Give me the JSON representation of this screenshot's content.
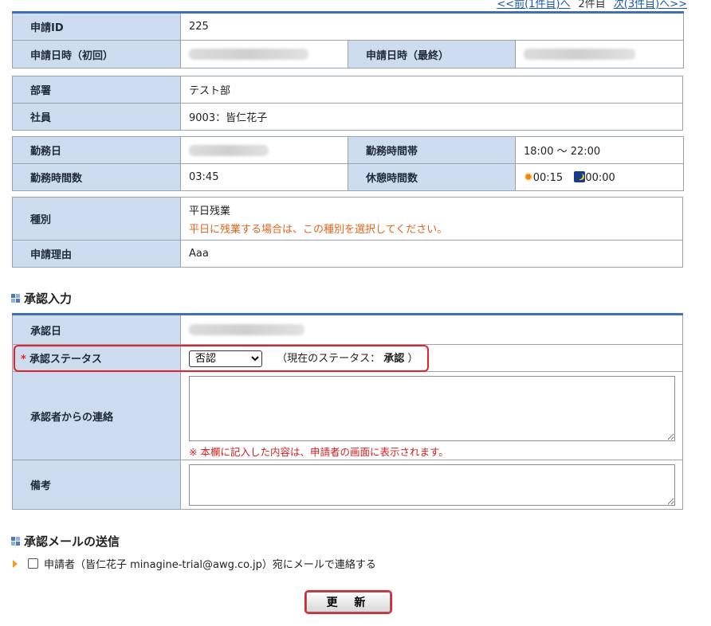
{
  "nav": {
    "prev": "<<前(1件目)へ",
    "current": "2件目",
    "next": "次(3件目)へ>>"
  },
  "request": {
    "id_label": "申請ID",
    "id_value": "225",
    "first_label": "申請日時（初回）",
    "last_label": "申請日時（最終）"
  },
  "employee": {
    "dept_label": "部署",
    "dept_value": "テスト部",
    "emp_label": "社員",
    "emp_value": "9003：皆仁花子"
  },
  "work": {
    "date_label": "勤務日",
    "timeband_label": "勤務時間帯",
    "timeband_value": "18:00 ～ 22:00",
    "hours_label": "勤務時間数",
    "hours_value": "03:45",
    "break_label": "休憩時間数",
    "break_day": "00:15",
    "break_night": "00:00"
  },
  "kind": {
    "type_label": "種別",
    "type_value": "平日残業",
    "type_note": "平日に残業する場合は、この種別を選択してください。",
    "reason_label": "申請理由",
    "reason_value": "Aaa"
  },
  "approval": {
    "section_title": "承認入力",
    "date_label": "承認日",
    "status_label": "承認ステータス",
    "required_mark": "*",
    "status_selected": "否認",
    "current_status_text": "（現在のステータス：",
    "current_status_value": "承認",
    "current_status_close": "）",
    "contact_label": "承認者からの連絡",
    "contact_value": "",
    "contact_note": "※ 本欄に記入した内容は、申請者の画面に表示されます。",
    "remarks_label": "備考",
    "remarks_value": ""
  },
  "mail": {
    "section_title": "承認メールの送信",
    "checkbox_label": "申請者（皆仁花子 minagine-trial@awg.co.jp）宛にメールで連絡する"
  },
  "update_button": "更 新",
  "icons": {
    "section": "grid-square-icon",
    "sun": "sun-icon",
    "moon": "moon-icon",
    "arrow": "orange-triangle-icon"
  },
  "colors": {
    "label_bg": "#cddcee",
    "header_line": "#3f6fb6",
    "highlight": "#e8202a",
    "note_orange": "#e0641c",
    "note_red": "#d62020"
  }
}
